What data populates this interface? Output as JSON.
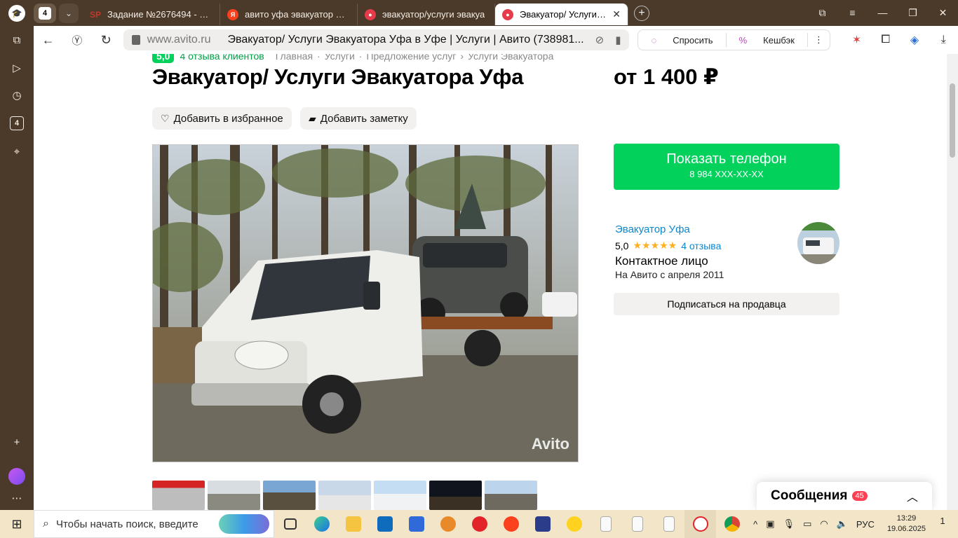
{
  "browser": {
    "tab_count": "4",
    "tabs": [
      {
        "title": "Задание №2676494 - про",
        "favicon": "SP",
        "color": "#9b3b1f"
      },
      {
        "title": "авито уфа эвакуатор — Я",
        "favicon": "Я",
        "color": "#fc3f1d"
      },
      {
        "title": "эвакуатор/услуги эвакуа",
        "favicon": "●",
        "color": "#e63b4a"
      },
      {
        "title": "Эвакуатор/ Услуги Эва",
        "favicon": "●",
        "color": "#e63b4a",
        "active": true
      }
    ],
    "url_domain": "www.avito.ru",
    "page_title": "Эвакуатор/ Услуги Эвакуатора Уфа в Уфе | Услуги | Авито (738981...",
    "ask_label": "Спросить",
    "cashback_label": "Кешбэк"
  },
  "listing": {
    "rating": "5,0",
    "reviews_link": "4 отзыва клиентов",
    "breadcrumbs": [
      "Главная",
      "Услуги",
      "Предложение услуг",
      "Услуги Эвакуатора"
    ],
    "title": "Эвакуатор/ Услуги Эвакуатора Уфа",
    "price": "от 1 400 ₽",
    "favorite_label": "Добавить в избранное",
    "note_label": "Добавить заметку",
    "watermark": "Avito",
    "thumb_count": 7
  },
  "contact": {
    "show_phone": "Показать телефон",
    "phone_masked": "8 984 XXX-XX-XX"
  },
  "seller": {
    "name": "Эвакуатор Уфа",
    "rating": "5,0",
    "stars": "★★★★★",
    "reviews": "4 отзыва",
    "type": "Контактное лицо",
    "since": "На Авито с апреля 2011",
    "subscribe": "Подписаться на продавца"
  },
  "messages": {
    "label": "Сообщения",
    "count": "45"
  },
  "taskbar": {
    "search_placeholder": "Чтобы начать поиск, введите",
    "lang": "РУС",
    "time": "13:29",
    "date": "19.06.2025",
    "notifications": "1"
  },
  "colors": {
    "brand_green": "#02d15c",
    "link_blue": "#0a88d0",
    "browser_frame": "#4b3a2a"
  }
}
